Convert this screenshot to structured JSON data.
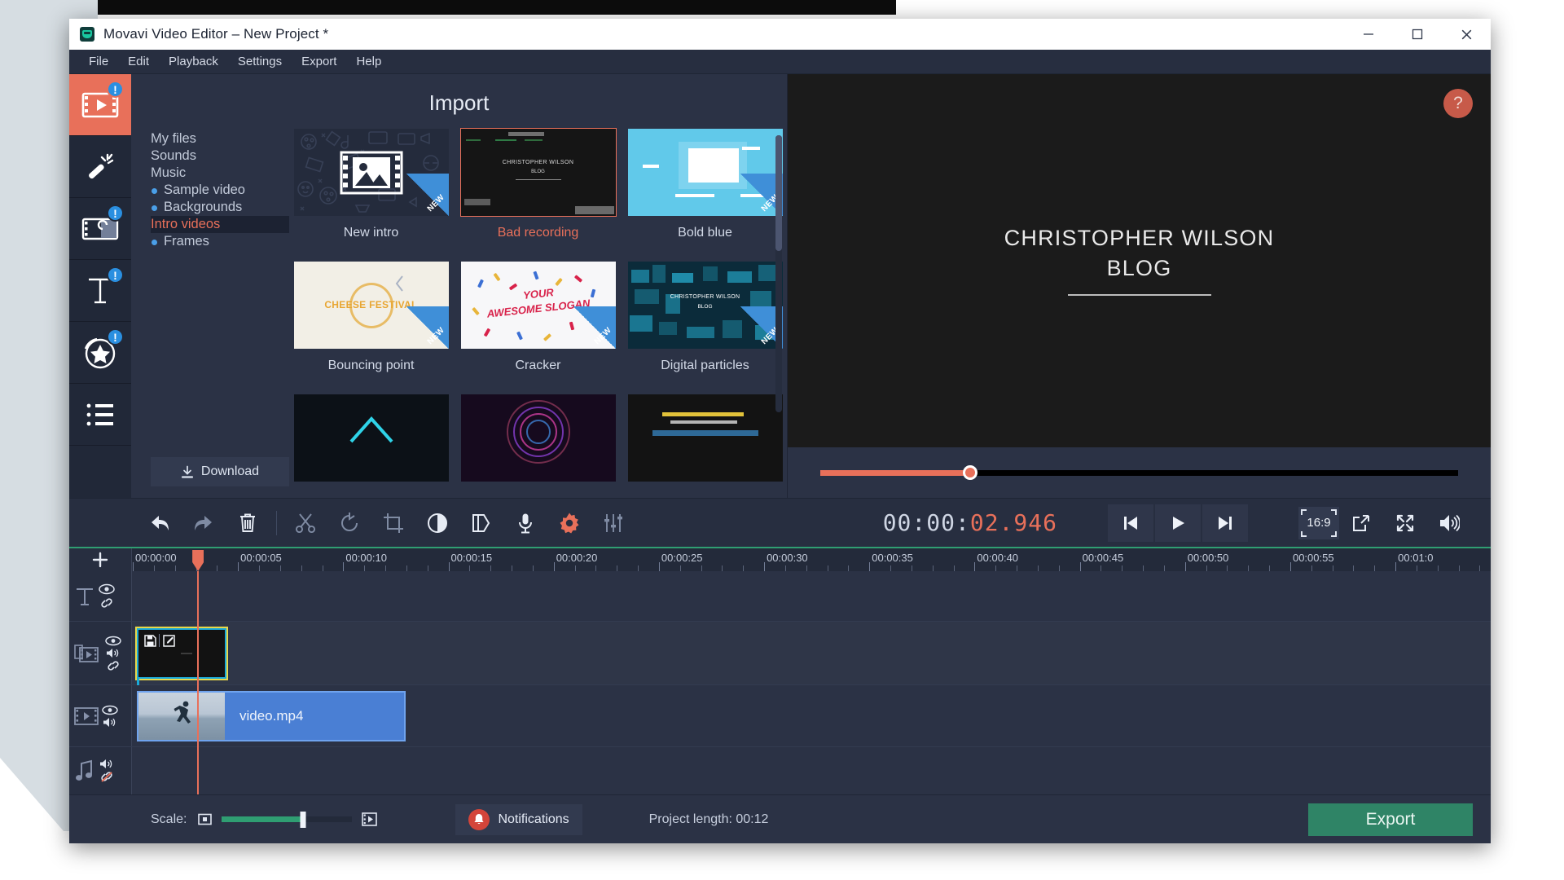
{
  "window": {
    "title": "Movavi Video Editor – New Project *",
    "minimize": "–",
    "maximize": "□",
    "close": "✕"
  },
  "menubar": {
    "items": [
      {
        "label": "File"
      },
      {
        "label": "Edit"
      },
      {
        "label": "Playback"
      },
      {
        "label": "Settings"
      },
      {
        "label": "Export"
      },
      {
        "label": "Help"
      }
    ]
  },
  "rail": {
    "items": [
      {
        "name": "import",
        "icon": "film-play-icon",
        "badge": "!",
        "active": true
      },
      {
        "name": "filters",
        "icon": "magic-wand-icon",
        "badge": "",
        "active": false
      },
      {
        "name": "transitions",
        "icon": "transition-icon",
        "badge": "!",
        "active": false
      },
      {
        "name": "titles",
        "icon": "text-t-icon",
        "badge": "!",
        "active": false
      },
      {
        "name": "stickers",
        "icon": "star-circle-icon",
        "badge": "!",
        "active": false
      },
      {
        "name": "more",
        "icon": "list-icon",
        "badge": "",
        "active": false
      }
    ]
  },
  "import": {
    "title": "Import",
    "categories": [
      {
        "label": "My files",
        "bullet": false,
        "selected": false
      },
      {
        "label": "Sounds",
        "bullet": false,
        "selected": false
      },
      {
        "label": "Music",
        "bullet": false,
        "selected": false
      },
      {
        "label": "Sample video",
        "bullet": true,
        "selected": false
      },
      {
        "label": "Backgrounds",
        "bullet": true,
        "selected": false
      },
      {
        "label": "Intro videos",
        "bullet": false,
        "selected": true
      },
      {
        "label": "Frames",
        "bullet": true,
        "selected": false
      }
    ],
    "download_label": "Download",
    "collapse_icon": "chevron-left-icon",
    "thumbnails": [
      {
        "label": "New intro",
        "art": "newintro",
        "new_badge": "NEW",
        "selected": false
      },
      {
        "label": "Bad recording",
        "art": "bad",
        "new_badge": "",
        "selected": true,
        "overlay_line1": "CHRISTOPHER WILSON",
        "overlay_line2": "BLOG"
      },
      {
        "label": "Bold blue",
        "art": "bold",
        "new_badge": "NEW",
        "selected": false
      },
      {
        "label": "Bouncing point",
        "art": "cheese",
        "new_badge": "NEW",
        "selected": false,
        "overlay_line1": "CHEESE FESTIVAL"
      },
      {
        "label": "Cracker",
        "art": "cracker",
        "new_badge": "NEW",
        "selected": false,
        "overlay_line1": "YOUR",
        "overlay_line2": "AWESOME SLOGAN"
      },
      {
        "label": "Digital particles",
        "art": "digital",
        "new_badge": "NEW",
        "selected": false,
        "overlay_line1": "CHRISTOPHER WILSON",
        "overlay_line2": "BLOG"
      },
      {
        "label": "",
        "art": "r3a",
        "new_badge": "",
        "selected": false
      },
      {
        "label": "",
        "art": "r3b",
        "new_badge": "",
        "selected": false
      },
      {
        "label": "",
        "art": "r3c",
        "new_badge": "",
        "selected": false
      }
    ]
  },
  "preview": {
    "help_label": "?",
    "line1": "CHRISTOPHER WILSON",
    "line2": "BLOG",
    "scrub_percent": 23.5
  },
  "toolbar": {
    "tools": [
      {
        "name": "undo-button",
        "icon": "undo-icon",
        "state": "enabled"
      },
      {
        "name": "redo-button",
        "icon": "redo-icon",
        "state": "dim"
      },
      {
        "name": "delete-button",
        "icon": "trash-icon",
        "state": "enabled"
      },
      {
        "name": "split-button",
        "icon": "scissors-icon",
        "state": "dim"
      },
      {
        "name": "rotate-button",
        "icon": "rotate-icon",
        "state": "dim"
      },
      {
        "name": "crop-button",
        "icon": "crop-icon",
        "state": "dim"
      },
      {
        "name": "color-adjust-button",
        "icon": "contrast-icon",
        "state": "enabled"
      },
      {
        "name": "stabilize-button",
        "icon": "clip-properties-icon",
        "state": "enabled"
      },
      {
        "name": "record-audio-button",
        "icon": "microphone-icon",
        "state": "enabled"
      },
      {
        "name": "clip-properties-button",
        "icon": "gear-icon",
        "state": "accent"
      },
      {
        "name": "audio-mixer-button",
        "icon": "sliders-icon",
        "state": "dim"
      }
    ],
    "timecode_prefix": "00:00:",
    "timecode_value": "02.946",
    "transport": [
      {
        "name": "previous-frame-button",
        "icon": "skip-back-icon"
      },
      {
        "name": "play-button",
        "icon": "play-icon"
      },
      {
        "name": "next-frame-button",
        "icon": "skip-forward-icon"
      }
    ],
    "aspect_ratio": "16:9",
    "detach_icon": "detach-window-icon",
    "fullscreen_icon": "fullscreen-icon",
    "volume_icon": "volume-icon"
  },
  "timeline": {
    "add_icon": "plus-icon",
    "ruler_labels": [
      "00:00:00",
      "00:00:05",
      "00:00:10",
      "00:00:15",
      "00:00:20",
      "00:00:25",
      "00:00:30",
      "00:00:35",
      "00:00:40",
      "00:00:45",
      "00:00:50",
      "00:00:55",
      "00:01:0"
    ],
    "playhead_time": "00:00:02.946",
    "tracks": [
      {
        "name": "titles-track",
        "icon": "text-t-icon",
        "toggles": [
          "eye-icon",
          "link-icon"
        ]
      },
      {
        "name": "overlay-track",
        "icon": "overlay-film-icon",
        "toggles": [
          "eye-icon",
          "volume-icon",
          "link-icon"
        ]
      },
      {
        "name": "video-track",
        "icon": "film-play-icon",
        "toggles": [
          "eye-icon",
          "volume-icon"
        ]
      },
      {
        "name": "audio-track",
        "icon": "music-note-icon",
        "toggles": [
          "volume-icon",
          "link-broken-icon"
        ]
      }
    ],
    "overlay_clip": {
      "name": "intro-clip",
      "save_icon": "save-icon",
      "edit_icon": "edit-icon"
    },
    "video_clip": {
      "name": "video.mp4"
    }
  },
  "bottombar": {
    "scale_label": "Scale:",
    "scale_percent": 62,
    "zoom_out_icon": "zoom-out-frame-icon",
    "zoom_in_icon": "zoom-in-frame-icon",
    "notifications_label": "Notifications",
    "notifications_icon": "bell-icon",
    "project_length_label": "Project length:",
    "project_length_value": "00:12",
    "export_label": "Export"
  },
  "colors": {
    "accent_orange": "#e8705a",
    "accent_green": "#2f8466",
    "accent_blue": "#4a7fd4",
    "panel_bg": "#2b3245",
    "rail_bg": "#212838"
  }
}
